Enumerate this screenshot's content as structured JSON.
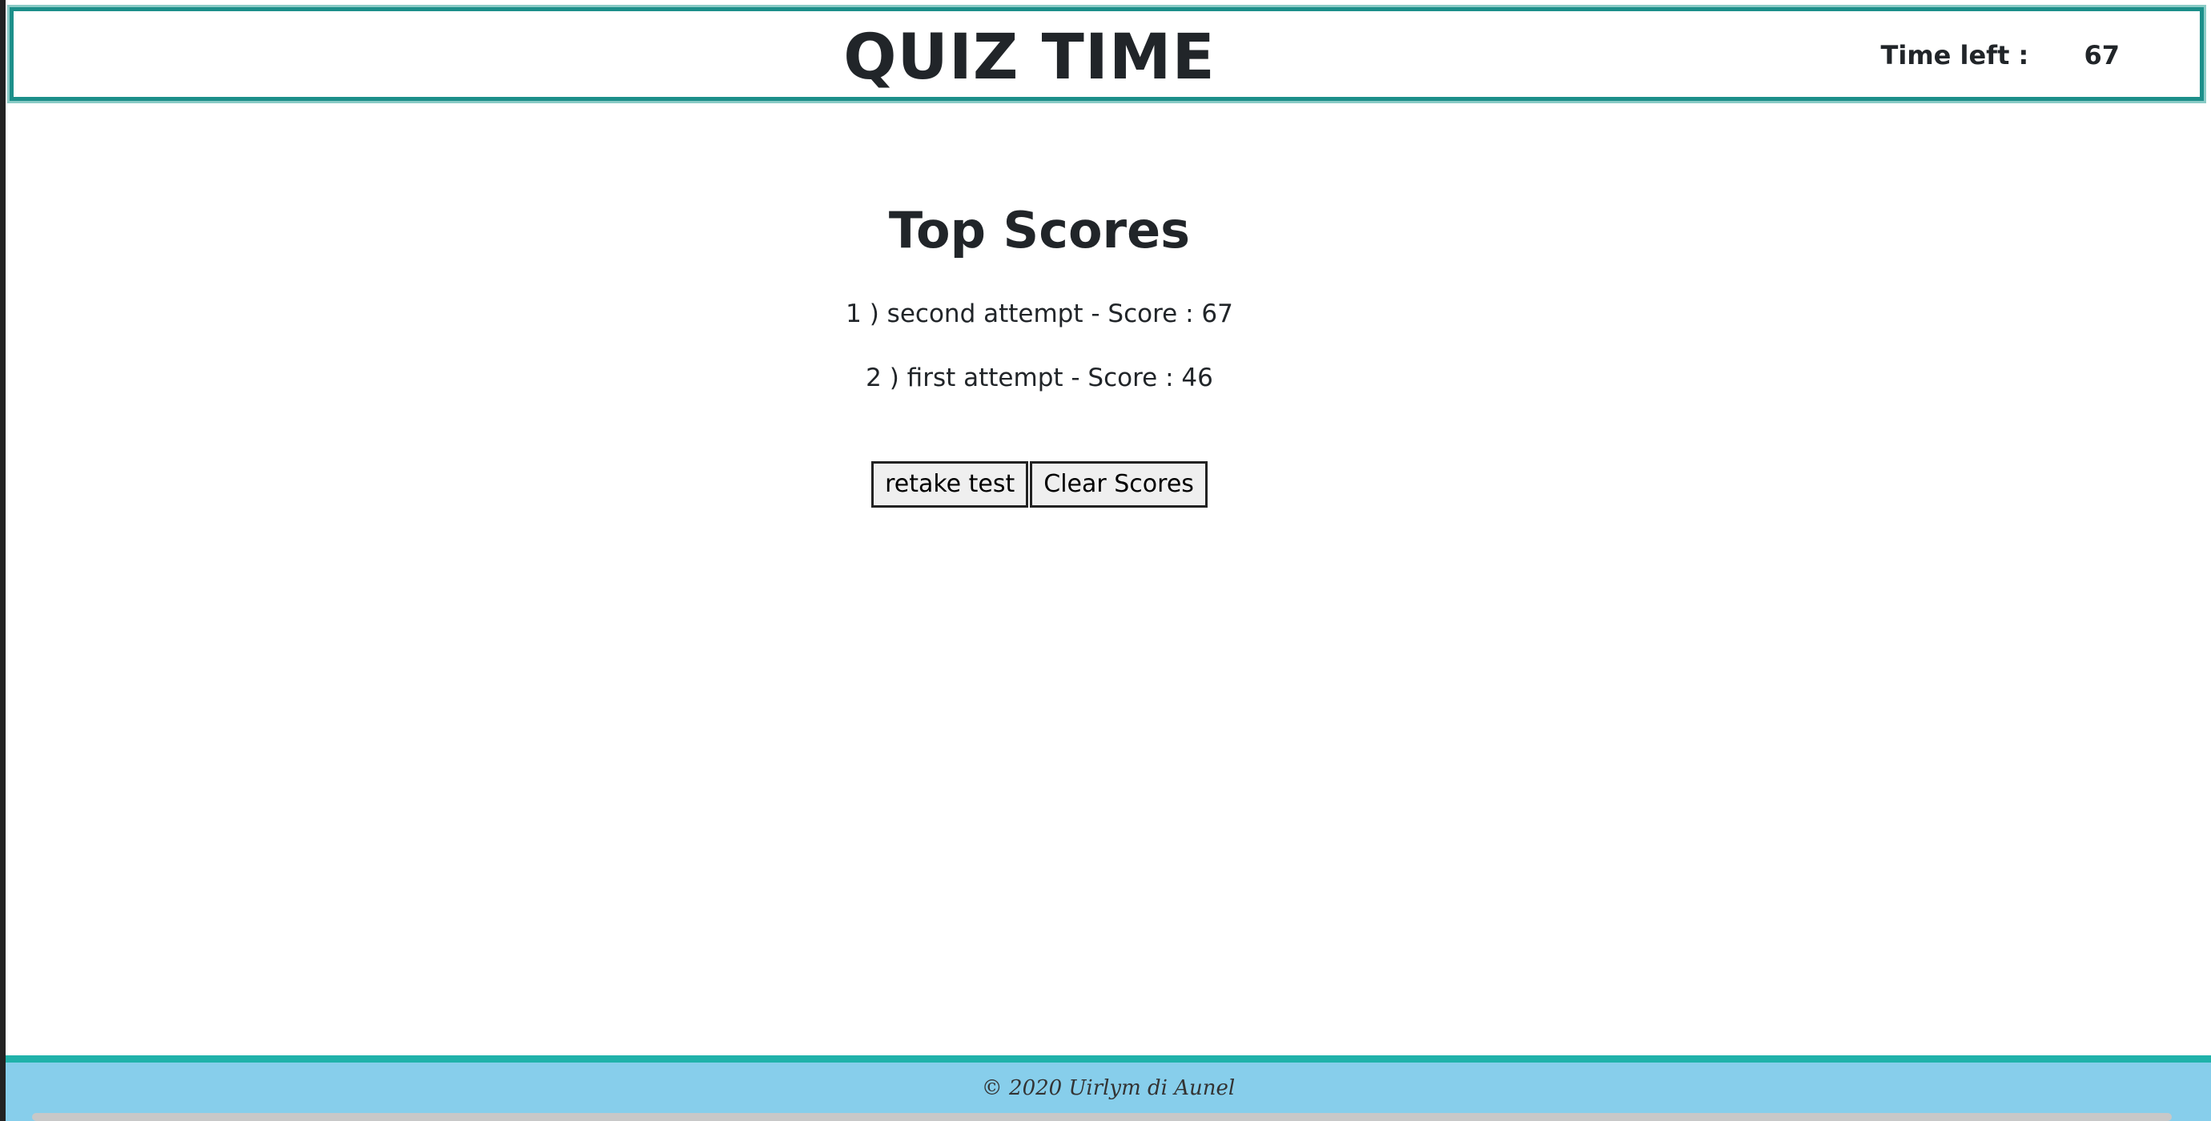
{
  "header": {
    "title": "QUIZ TIME",
    "timer_label": "Time left :",
    "timer_value": "67"
  },
  "scores": {
    "heading": "Top Scores",
    "items": [
      "1 ) second attempt - Score : 67",
      "2 ) first attempt - Score : 46"
    ]
  },
  "buttons": {
    "retake_label": "retake test",
    "clear_label": "Clear Scores"
  },
  "footer": {
    "text": "© 2020 Uirlym di Aunel"
  },
  "colors": {
    "header_border": "#1c8f8a",
    "footer_bg": "#87ceeb",
    "footer_border": "#20b2aa"
  }
}
